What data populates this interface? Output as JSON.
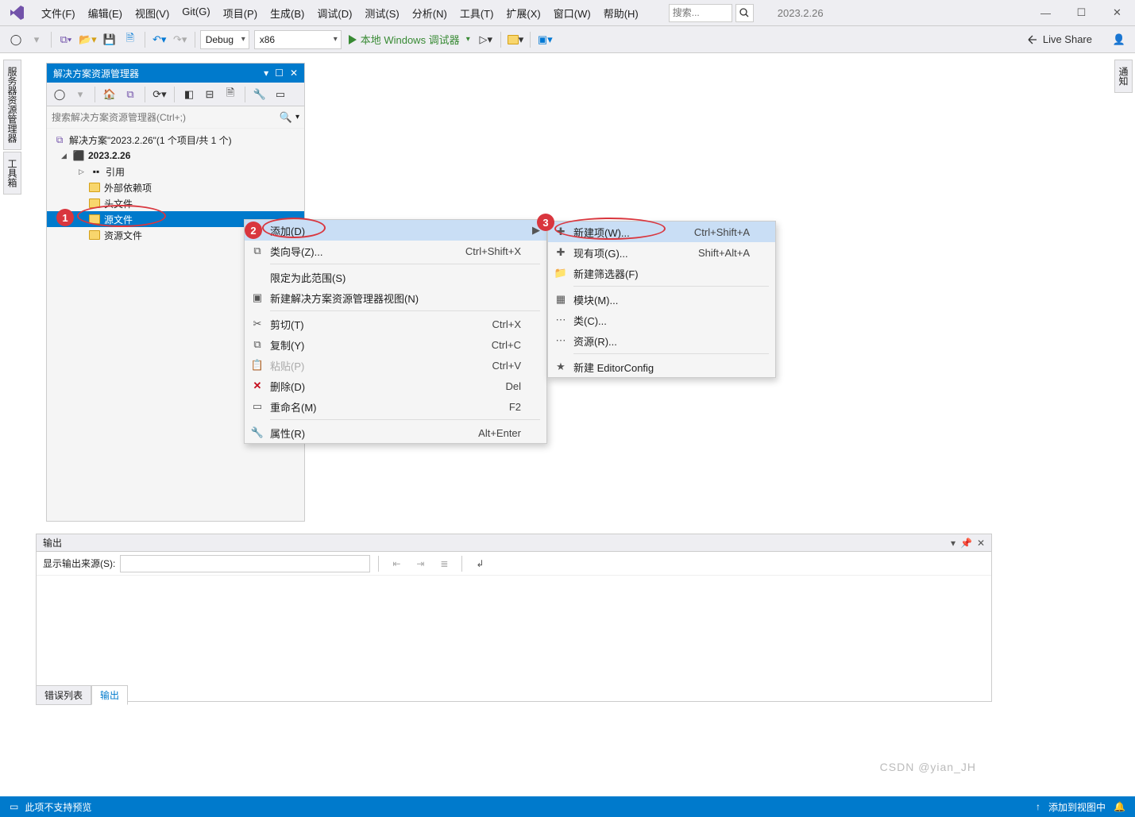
{
  "titlebar": {
    "menu": [
      "文件(F)",
      "编辑(E)",
      "视图(V)",
      "Git(G)",
      "项目(P)",
      "生成(B)",
      "调试(D)",
      "测试(S)",
      "分析(N)",
      "工具(T)",
      "扩展(X)",
      "窗口(W)",
      "帮助(H)"
    ],
    "search_placeholder": "搜索...",
    "project_name": "2023.2.26"
  },
  "toolbar": {
    "config": "Debug",
    "platform": "x86",
    "debug_target": "本地 Windows 调试器",
    "liveshare": "Live Share"
  },
  "left_tabs": [
    "服务器资源管理器",
    "工具箱"
  ],
  "right_tabs": [
    "通知"
  ],
  "solution_explorer": {
    "title": "解决方案资源管理器",
    "search_placeholder": "搜索解决方案资源管理器(Ctrl+;)",
    "root": "解决方案\"2023.2.26\"(1 个项目/共 1 个)",
    "project": "2023.2.26",
    "nodes": {
      "refs": "引用",
      "external": "外部依赖项",
      "headers": "头文件",
      "sources": "源文件",
      "resources": "资源文件"
    }
  },
  "context_menu": {
    "items": [
      {
        "label": "添加(D)",
        "shortcut": "",
        "arrow": true,
        "highlight": true,
        "icon": ""
      },
      {
        "label": "类向导(Z)...",
        "shortcut": "Ctrl+Shift+X",
        "icon": "wizard"
      },
      {
        "sep": true
      },
      {
        "label": "限定为此范围(S)",
        "shortcut": "",
        "icon": ""
      },
      {
        "label": "新建解决方案资源管理器视图(N)",
        "shortcut": "",
        "icon": "newview"
      },
      {
        "sep": true
      },
      {
        "label": "剪切(T)",
        "shortcut": "Ctrl+X",
        "icon": "cut"
      },
      {
        "label": "复制(Y)",
        "shortcut": "Ctrl+C",
        "icon": "copy"
      },
      {
        "label": "粘贴(P)",
        "shortcut": "Ctrl+V",
        "icon": "paste",
        "disabled": true
      },
      {
        "label": "删除(D)",
        "shortcut": "Del",
        "icon": "delete"
      },
      {
        "label": "重命名(M)",
        "shortcut": "F2",
        "icon": "rename"
      },
      {
        "sep": true
      },
      {
        "label": "属性(R)",
        "shortcut": "Alt+Enter",
        "icon": "wrench"
      }
    ]
  },
  "sub_menu": {
    "items": [
      {
        "label": "新建项(W)...",
        "shortcut": "Ctrl+Shift+A",
        "icon": "newitem",
        "highlight": true
      },
      {
        "label": "现有项(G)...",
        "shortcut": "Shift+Alt+A",
        "icon": "existitem"
      },
      {
        "label": "新建筛选器(F)",
        "shortcut": "",
        "icon": "filter"
      },
      {
        "sep": true
      },
      {
        "label": "模块(M)...",
        "shortcut": "",
        "icon": "module"
      },
      {
        "label": "类(C)...",
        "shortcut": "",
        "icon": "class"
      },
      {
        "label": "资源(R)...",
        "shortcut": "",
        "icon": "resource"
      },
      {
        "sep": true
      },
      {
        "label": "新建 EditorConfig",
        "shortcut": "",
        "icon": "editorconfig"
      }
    ]
  },
  "output": {
    "title": "输出",
    "source_label": "显示输出来源(S):"
  },
  "bottom_tabs": {
    "errors": "错误列表",
    "output": "输出"
  },
  "statusbar": {
    "left": "此项不支持预览",
    "right": "添加到视图中"
  },
  "callouts": {
    "c1": "1",
    "c2": "2",
    "c3": "3"
  },
  "watermark": "CSDN @yian_JH"
}
